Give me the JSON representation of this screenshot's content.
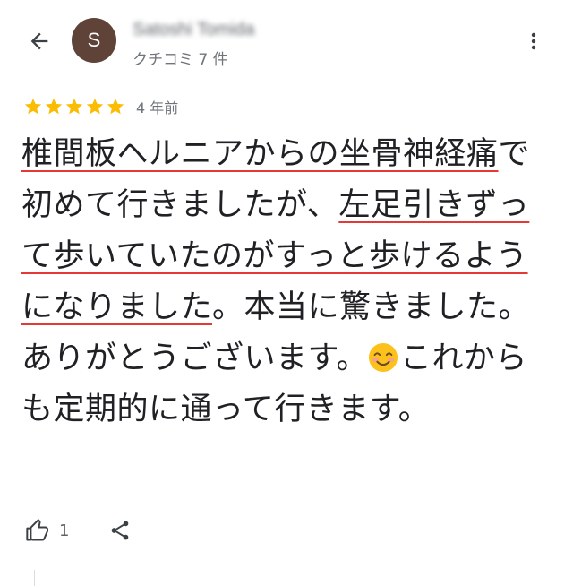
{
  "header": {
    "avatar_letter": "S",
    "avatar_color": "#5f4339",
    "author_name": "Satoshi Tomida",
    "author_meta": "クチコミ 7 件"
  },
  "rating": {
    "stars": 5,
    "max_stars": 5,
    "star_color": "#fbbc04",
    "date": "4 年前"
  },
  "review": {
    "segments": [
      {
        "text": "椎間板ヘルニアからの坐骨神経痛",
        "underline": true
      },
      {
        "text": "で初めて行きましたが、",
        "underline": false
      },
      {
        "text": "左足引きずって歩いていたのがすっと歩けるようになりました",
        "underline": true
      },
      {
        "text": "。本当に驚きました。ありがとうございます。",
        "underline": false
      },
      {
        "text": "これからも定期的に通って行きます。",
        "underline": false,
        "emoji_before": "smiling-face-emoji"
      }
    ],
    "underline_color": "#e53935"
  },
  "actions": {
    "like_count": "1",
    "like_icon": "thumbs-up-icon",
    "share_icon": "share-icon"
  }
}
